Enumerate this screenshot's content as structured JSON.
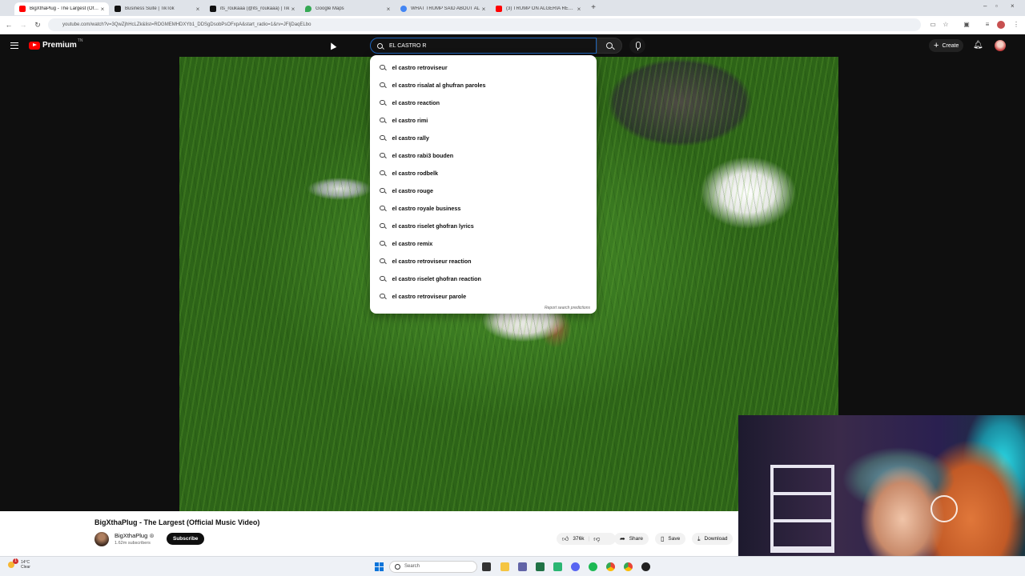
{
  "browser": {
    "tabs": [
      {
        "title": "BigXthaPlug - The Largest (Offi...",
        "color": "#ff0000",
        "active": true
      },
      {
        "title": "Business Suite | TikTok",
        "color": "#111111",
        "active": false
      },
      {
        "title": "its_roukaaa (@its_roukaaa) | Tik",
        "color": "#111111",
        "active": false
      },
      {
        "title": "Google Maps",
        "color": "#34a853",
        "active": false
      },
      {
        "title": "WHAT TRUMP SAID ABOUT AL",
        "color": "#4285f4",
        "active": false
      },
      {
        "title": "(3) TRUMP ON ALGERIA REGIME",
        "color": "#ff0000",
        "active": false
      }
    ],
    "url": "youtube.com/watch?v=3QwZjhHcLZk&list=RDGMEMHDXYb1_DDSgDsobPsOFxpA&start_radio=1&rv=JFIjDaqELbo"
  },
  "youtube": {
    "logo_text": "Premium",
    "logo_sup": "TN",
    "search_value": "EL CASTRO R",
    "create_label": "Create",
    "suggestions": [
      "el castro retroviseur",
      "el castro risalat al ghufran paroles",
      "el castro reaction",
      "el castro rimi",
      "el castro rally",
      "el castro rabi3 bouden",
      "el castro rodbelk",
      "el castro rouge",
      "el castro royale business",
      "el castro riselet ghofran lyrics",
      "el castro remix",
      "el castro retroviseur reaction",
      "el castro riselet ghofran reaction",
      "el castro retroviseur parole"
    ],
    "report_label": "Report search predictions",
    "video_title": "BigXthaPlug - The Largest (Official Music Video)",
    "channel_name": "BigXthaPlug",
    "channel_subs": "1.62m subscribers",
    "subscribe_label": "Subscribe",
    "like_count": "376k",
    "share_label": "Share",
    "save_label": "Save",
    "download_label": "Download"
  },
  "taskbar": {
    "temp": "14°C",
    "weather": "Clear",
    "badge": "1",
    "search_placeholder": "Search"
  }
}
